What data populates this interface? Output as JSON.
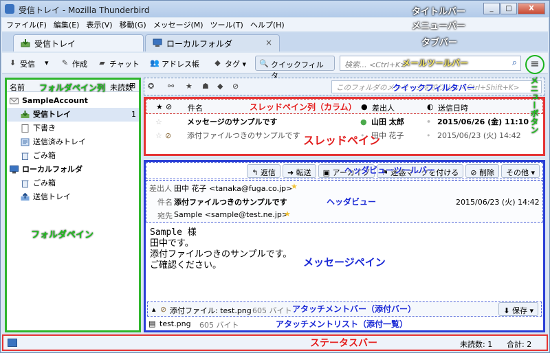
{
  "window": {
    "title": "受信トレイ - Mozilla Thunderbird",
    "min": "_",
    "max": "□",
    "close": "X"
  },
  "menu": [
    "ファイル(F)",
    "編集(E)",
    "表示(V)",
    "移動(G)",
    "メッセージ(M)",
    "ツール(T)",
    "ヘルプ(H)"
  ],
  "tabs": {
    "active": "受信トレイ",
    "inactive": "ローカルフォルダ",
    "close": "×"
  },
  "toolbar": {
    "get": "受信",
    "write": "作成",
    "chat": "チャット",
    "address": "アドレス帳",
    "tag": "タグ",
    "quickfilter": "クイックフィルタ",
    "search_placeholder": "検索... <Ctrl+K>"
  },
  "folderpane": {
    "col_name": "名前",
    "col_unread": "未読数",
    "items": [
      {
        "label": "SampleAccount",
        "count": ""
      },
      {
        "label": "受信トレイ",
        "count": "1"
      },
      {
        "label": "下書き",
        "count": ""
      },
      {
        "label": "送信済みトレイ",
        "count": ""
      },
      {
        "label": "ごみ箱",
        "count": ""
      },
      {
        "label": "ローカルフォルダ",
        "count": ""
      },
      {
        "label": "ごみ箱",
        "count": ""
      },
      {
        "label": "送信トレイ",
        "count": ""
      }
    ]
  },
  "quickfilter": {
    "placeholder": "このフォルダのメッセージを絞り込む <Ctrl+Shift+K>"
  },
  "thread": {
    "col_subject": "件名",
    "col_from": "差出人",
    "col_date": "送信日時",
    "rows": [
      {
        "subject": "メッセージのサンプルです",
        "from": "山田 太郎",
        "date": "2015/06/26 (金) 11:10"
      },
      {
        "subject": "添付ファイルつきのサンプルです",
        "from": "田中 花子",
        "date": "2015/06/23 (火) 14:42"
      }
    ]
  },
  "headerview": {
    "buttons": [
      "返信",
      "転送",
      "アーカイブ",
      "迷惑マークを付ける",
      "削除",
      "その他"
    ],
    "from_label": "差出人",
    "from": "田中 花子 <tanaka@fuga.co.jp>",
    "subject_label": "件名",
    "subject": "添付ファイルつきのサンプルです",
    "date": "2015/06/23 (火) 14:42",
    "to_label": "宛先",
    "to": "Sample <sample@test.ne.jp>"
  },
  "body": [
    "Sample 様",
    "田中です。",
    "添付ファイルつきのサンプルです。",
    "ご確認ください。"
  ],
  "attachment": {
    "bar": "添付ファイル: test.png",
    "bar_size": "605 バイト",
    "save": "保存",
    "file": "test.png",
    "file_size": "605 バイト"
  },
  "status": {
    "unread": "未読数: 1",
    "total": "合計: 2"
  },
  "annotations": {
    "titlebar": "タイトルバー",
    "menubar": "メニューバー",
    "tabbar": "タブバー",
    "mailtoolbar": "メールツールバー",
    "menubutton": "メニューボタン",
    "foldercol": "フォルダペイン列",
    "quickfilterbar": "クイックフィルタバー",
    "threadcol": "スレッドペイン列（カラム）",
    "threadpane": "スレッドペイン",
    "headertoolbar": "ヘッダビューツールバー",
    "headerview": "ヘッダビュー",
    "folderpane": "フォルダペイン",
    "messagepane": "メッセージペイン",
    "attachbar": "アタッチメントバー（添付バー）",
    "attachlist": "アタッチメントリスト（添付一覧）",
    "statusbar": "ステータスバー"
  },
  "colors": {
    "folderpane_border": "#2fb62c",
    "threadpane_border": "#e53333",
    "messagepane_border": "#2a3fd6"
  }
}
